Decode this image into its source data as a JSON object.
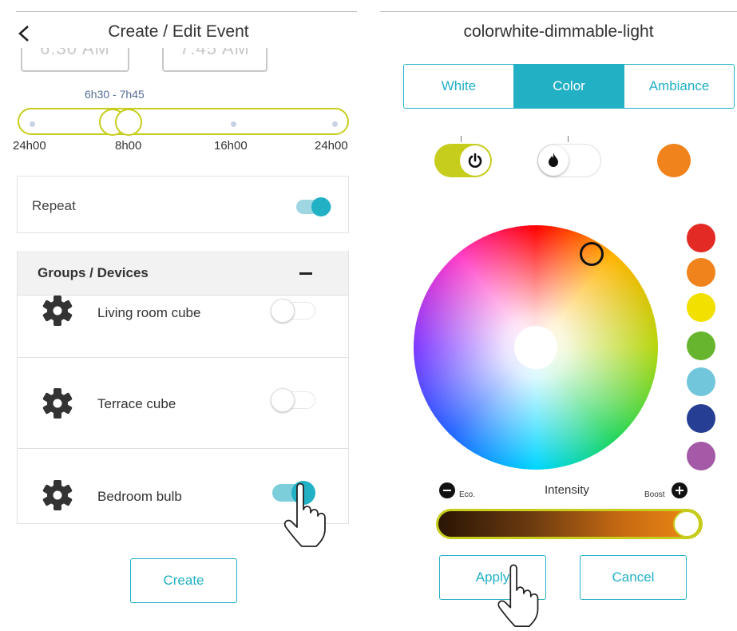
{
  "left": {
    "header": {
      "title": "Create / Edit Event"
    },
    "time_inputs": {
      "start": "6:30 AM",
      "end": "7:45 AM"
    },
    "range": {
      "label": "6h30 - 7h45"
    },
    "timeline_ticks": [
      "24h00",
      "8h00",
      "16h00",
      "24h00"
    ],
    "repeat": {
      "label": "Repeat",
      "on": true
    },
    "groups": {
      "header": "Groups / Devices",
      "items": [
        {
          "label": "Living room cube",
          "on": false
        },
        {
          "label": "Terrace cube",
          "on": false
        },
        {
          "label": "Bedroom bulb",
          "on": true
        }
      ]
    },
    "create_label": "Create"
  },
  "right": {
    "header": {
      "title": "colorwhite-dimmable-light"
    },
    "tabs": [
      {
        "label": "White",
        "active": false
      },
      {
        "label": "Color",
        "active": true
      },
      {
        "label": "Ambiance",
        "active": false
      }
    ],
    "current_color": "#f0831c",
    "swatches": [
      "#e32a24",
      "#f0831c",
      "#f1e000",
      "#67b52e",
      "#72c6dc",
      "#263f95",
      "#a45aa6"
    ],
    "intensity": {
      "label": "Intensity",
      "min_label": "Eco.",
      "max_label": "Boost",
      "value": 1.0
    },
    "apply_label": "Apply",
    "cancel_label": "Cancel"
  },
  "colors": {
    "accent": "#22b0c5",
    "lime": "#c7cd1d"
  },
  "icons": [
    "back-chevron-icon",
    "gear-icon",
    "minus-icon",
    "power-icon",
    "flame-icon",
    "hand-pointer-icon"
  ]
}
